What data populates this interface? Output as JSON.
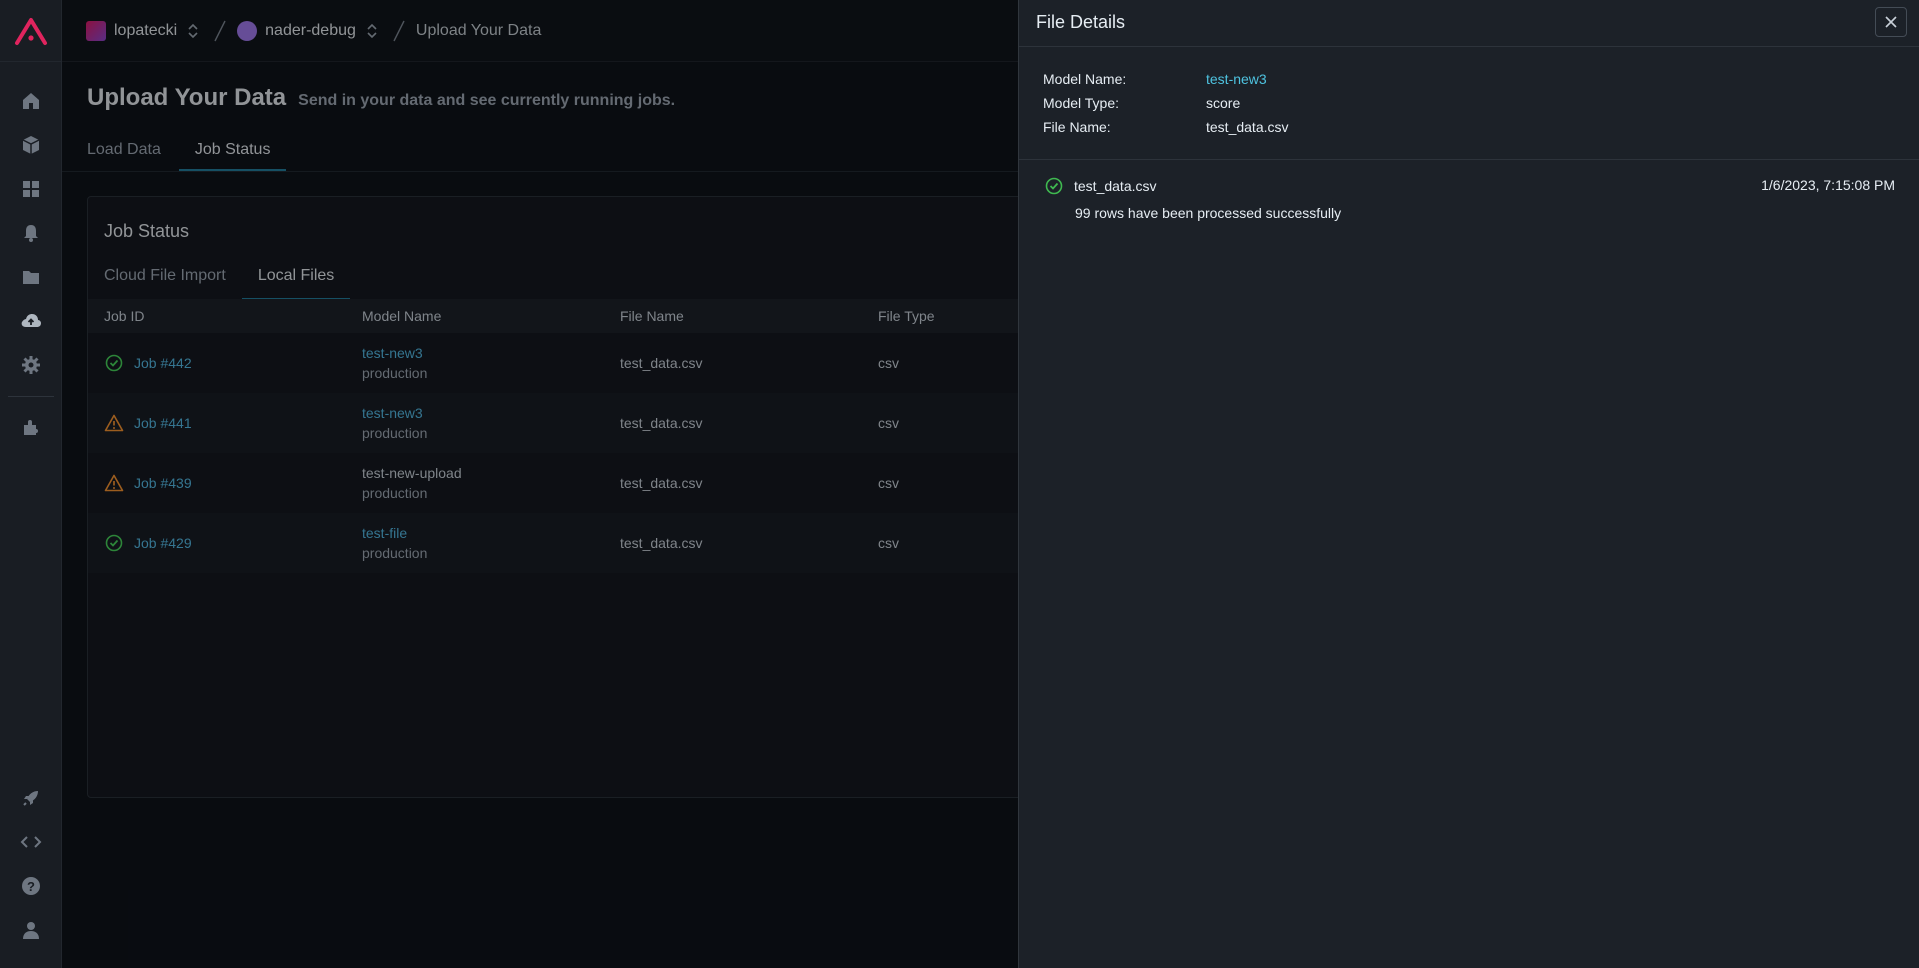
{
  "breadcrumb": {
    "org": "lopatecki",
    "project": "nader-debug",
    "page": "Upload Your Data"
  },
  "page": {
    "title": "Upload Your Data",
    "subtitle": "Send in your data and see currently running jobs."
  },
  "tabs": [
    {
      "label": "Load Data",
      "active": false
    },
    {
      "label": "Job Status",
      "active": true
    }
  ],
  "job_status": {
    "title": "Job Status",
    "subtabs": [
      {
        "label": "Cloud File Import",
        "active": false
      },
      {
        "label": "Local Files",
        "active": true
      }
    ],
    "columns": [
      "Job ID",
      "Model Name",
      "File Name",
      "File Type"
    ],
    "rows": [
      {
        "status": "success",
        "job": "Job #442",
        "model": "test-new3",
        "model_link": true,
        "env": "production",
        "file": "test_data.csv",
        "type": "csv"
      },
      {
        "status": "warning",
        "job": "Job #441",
        "model": "test-new3",
        "model_link": true,
        "env": "production",
        "file": "test_data.csv",
        "type": "csv"
      },
      {
        "status": "warning",
        "job": "Job #439",
        "model": "test-new-upload",
        "model_link": false,
        "env": "production",
        "file": "test_data.csv",
        "type": "csv"
      },
      {
        "status": "success",
        "job": "Job #429",
        "model": "test-file",
        "model_link": true,
        "env": "production",
        "file": "test_data.csv",
        "type": "csv"
      }
    ]
  },
  "drawer": {
    "title": "File Details",
    "model_name_label": "Model Name:",
    "model_name": "test-new3",
    "model_type_label": "Model Type:",
    "model_type": "score",
    "file_name_label": "File Name:",
    "file_name": "test_data.csv",
    "entry": {
      "file": "test_data.csv",
      "timestamp": "1/6/2023, 7:15:08 PM",
      "message": "99 rows have been processed successfully"
    }
  },
  "colors": {
    "success": "#3fb950",
    "warning": "#d9822b",
    "link": "#4aa3c9",
    "brand": "#e0245e"
  }
}
